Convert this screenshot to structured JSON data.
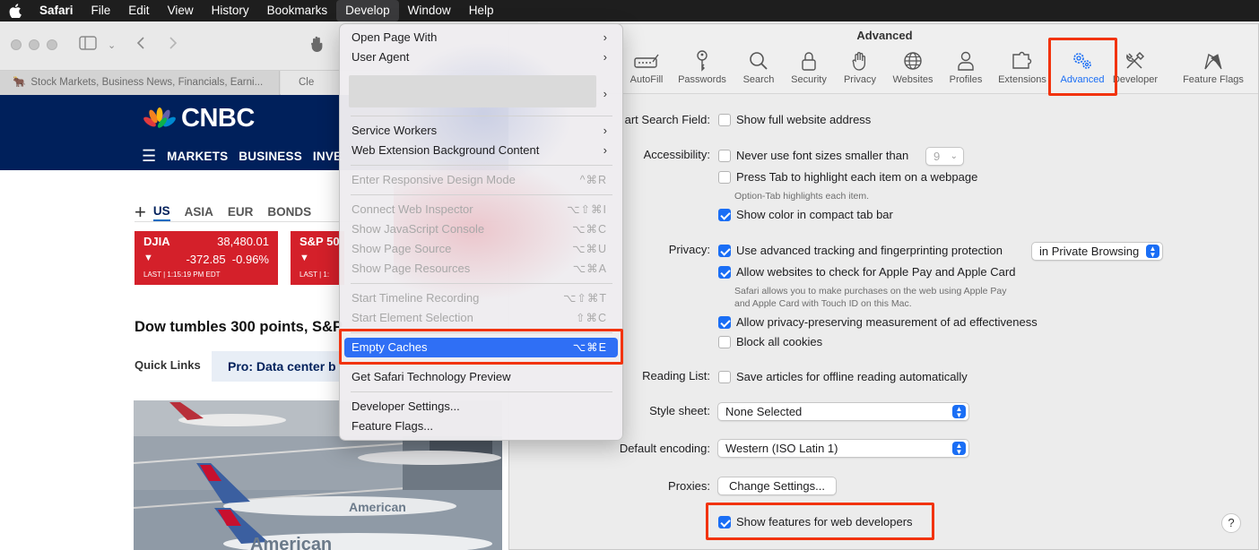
{
  "menubar": {
    "app": "Safari",
    "items": [
      "File",
      "Edit",
      "View",
      "History",
      "Bookmarks",
      "Develop",
      "Window",
      "Help"
    ]
  },
  "browser": {
    "tabs": [
      {
        "label": "Stock Markets, Business News, Financials, Earni..."
      },
      {
        "label": "Cle"
      }
    ],
    "cnbc": {
      "logo_text": "CNBC",
      "nav": [
        "MARKETS",
        "BUSINESS",
        "INVE"
      ],
      "market_tabs": [
        "US",
        "ASIA",
        "EUR",
        "BONDS"
      ],
      "tiles": [
        {
          "name": "DJIA",
          "value": "38,480.01",
          "arrow": "▼",
          "change": "-372.85",
          "pct": "-0.96%",
          "time": "LAST | 1:15:19 PM EDT"
        },
        {
          "name": "S&P 50",
          "value": "",
          "arrow": "▼",
          "change": "",
          "pct": "",
          "time": "LAST | 1:"
        }
      ],
      "headline": "Dow tumbles 300 points, S&P",
      "quick_links_label": "Quick Links",
      "quick_link_pill": "Pro: Data center b",
      "photo_text_1": "American",
      "photo_text_2": "American"
    }
  },
  "develop_menu": {
    "items": [
      {
        "label": "Open Page With",
        "shortcut": "",
        "submenu": true,
        "disabled": false
      },
      {
        "label": "User Agent",
        "shortcut": "",
        "submenu": true,
        "disabled": false
      },
      {
        "label": "Service Workers",
        "shortcut": "",
        "submenu": true,
        "disabled": false
      },
      {
        "label": "Web Extension Background Content",
        "shortcut": "",
        "submenu": true,
        "disabled": false
      },
      {
        "label": "Enter Responsive Design Mode",
        "shortcut": "^⌘R",
        "submenu": false,
        "disabled": true
      },
      {
        "label": "Connect Web Inspector",
        "shortcut": "⌥⇧⌘I",
        "submenu": false,
        "disabled": true
      },
      {
        "label": "Show JavaScript Console",
        "shortcut": "⌥⌘C",
        "submenu": false,
        "disabled": true
      },
      {
        "label": "Show Page Source",
        "shortcut": "⌥⌘U",
        "submenu": false,
        "disabled": true
      },
      {
        "label": "Show Page Resources",
        "shortcut": "⌥⌘A",
        "submenu": false,
        "disabled": true
      },
      {
        "label": "Start Timeline Recording",
        "shortcut": "⌥⇧⌘T",
        "submenu": false,
        "disabled": true
      },
      {
        "label": "Start Element Selection",
        "shortcut": "⇧⌘C",
        "submenu": false,
        "disabled": true
      },
      {
        "label": "Empty Caches",
        "shortcut": "⌥⌘E",
        "submenu": false,
        "disabled": false,
        "highlighted": true
      },
      {
        "label": "Get Safari Technology Preview",
        "shortcut": "",
        "submenu": false,
        "disabled": false
      },
      {
        "label": "Developer Settings...",
        "shortcut": "",
        "submenu": false,
        "disabled": false
      },
      {
        "label": "Feature Flags...",
        "shortcut": "",
        "submenu": false,
        "disabled": false
      }
    ]
  },
  "settings": {
    "title": "Advanced",
    "panes": [
      {
        "label": "AutoFill",
        "icon": "autofill-icon"
      },
      {
        "label": "Passwords",
        "icon": "key-icon"
      },
      {
        "label": "Search",
        "icon": "search-icon"
      },
      {
        "label": "Security",
        "icon": "lock-icon"
      },
      {
        "label": "Privacy",
        "icon": "hand-icon"
      },
      {
        "label": "Websites",
        "icon": "globe-icon"
      },
      {
        "label": "Profiles",
        "icon": "person-icon"
      },
      {
        "label": "Extensions",
        "icon": "puzzle-icon"
      },
      {
        "label": "Advanced",
        "icon": "gears-icon",
        "selected": true
      },
      {
        "label": "Developer",
        "icon": "tools-icon"
      },
      {
        "label": "Feature Flags",
        "icon": "flags-icon"
      }
    ],
    "smart_search_label": "art Search Field:",
    "show_full_address": "Show full website address",
    "accessibility_label": "Accessibility:",
    "never_font_size": "Never use font sizes smaller than",
    "font_size_value": "9",
    "press_tab": "Press Tab to highlight each item on a webpage",
    "press_tab_note": "Option-Tab highlights each item.",
    "show_color_tab_bar": "Show color in compact tab bar",
    "privacy_label": "Privacy:",
    "advanced_tracking": "Use advanced tracking and fingerprinting protection",
    "tracking_scope": "in Private Browsing",
    "apple_pay": "Allow websites to check for Apple Pay and Apple Card",
    "apple_pay_note_1": "Safari allows you to make purchases on the web using Apple Pay",
    "apple_pay_note_2": "and Apple Card with Touch ID on this Mac.",
    "privacy_ad": "Allow privacy-preserving measurement of ad effectiveness",
    "block_cookies": "Block all cookies",
    "reading_list_label": "Reading List:",
    "save_articles": "Save articles for offline reading automatically",
    "style_sheet_label": "Style sheet:",
    "style_sheet_value": "None Selected",
    "encoding_label": "Default encoding:",
    "encoding_value": "Western (ISO Latin 1)",
    "proxies_label": "Proxies:",
    "change_settings": "Change Settings...",
    "show_dev_features": "Show features for web developers",
    "help": "?"
  },
  "colors": {
    "accent": "#1a6ef5",
    "annotation": "#f2330d",
    "cnbc_navy": "#00205b",
    "ticker_red": "#d4202a"
  }
}
